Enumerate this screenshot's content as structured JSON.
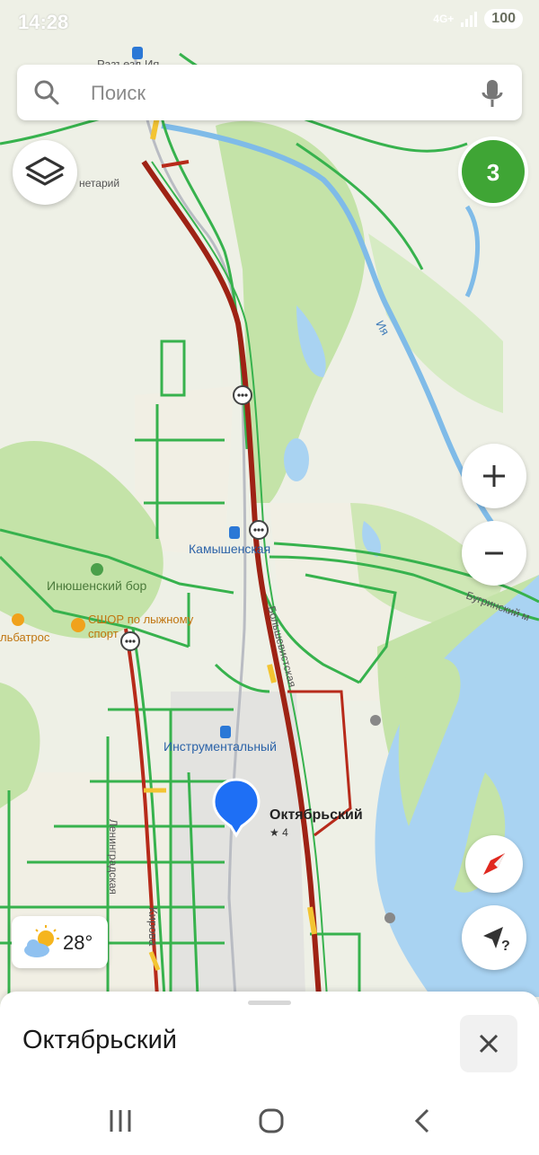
{
  "status_bar": {
    "time": "14:28",
    "network": "4G+",
    "battery": "100"
  },
  "search": {
    "placeholder": "Поиск",
    "icon": "search-icon",
    "voice_icon": "microphone-icon"
  },
  "controls": {
    "layers_icon": "layers-icon",
    "counter": "3",
    "zoom_in": "+",
    "zoom_out": "−",
    "compass_icon": "compass-icon",
    "locate_icon": "locate-arrow-icon",
    "locate_suffix": "?"
  },
  "weather": {
    "icon": "partly-cloudy-icon",
    "temperature": "28°"
  },
  "map": {
    "labels": {
      "razyezd": "Разъезд Ия",
      "planetary": "нетарий",
      "river_iya": "Ия",
      "kamyshenskaya": "Камышенская",
      "inyushenskiy": "Инюшенский бор",
      "sshor": "СШОР по лыжному",
      "sshor2": "спорт",
      "albatros": "льбатрос",
      "bugrinsky": "Бугринский м",
      "bolshevistskaya": "Большевистская",
      "instrumentalny": "Инструментальный",
      "oktyabrsky": "Октябрьский",
      "rating": "★ 4",
      "leningradskaya": "Ленинградская",
      "kirova": "Кирова"
    },
    "colors": {
      "water": "#a9d3f2",
      "forest": "#c4e3a8",
      "road_green": "#37b24d",
      "road_red": "#b72a1a",
      "road_yellow": "#f3c432",
      "pin": "#1e6ff5"
    }
  },
  "place_card": {
    "title": "Октябрьский",
    "close_icon": "close-icon"
  },
  "nav": {
    "recents_icon": "recents-icon",
    "home_icon": "home-icon",
    "back_icon": "back-icon"
  }
}
